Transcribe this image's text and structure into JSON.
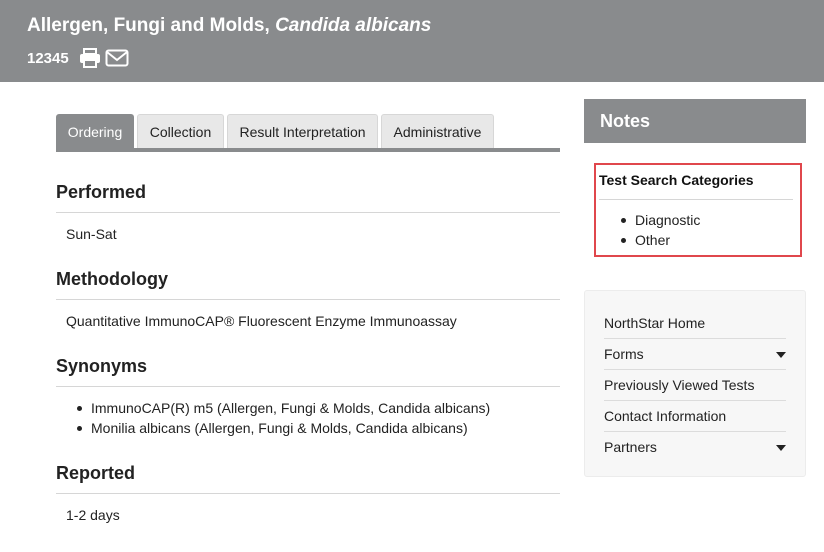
{
  "header": {
    "title_main": "Allergen, Fungi and Molds, ",
    "title_italic": "Candida albicans",
    "code": "12345",
    "print_icon": "printer-icon",
    "email_icon": "envelope-icon"
  },
  "tabs": [
    {
      "label": "Ordering",
      "active": true
    },
    {
      "label": "Collection",
      "active": false
    },
    {
      "label": "Result Interpretation",
      "active": false
    },
    {
      "label": "Administrative",
      "active": false
    }
  ],
  "sections": {
    "performed": {
      "title": "Performed",
      "value": "Sun-Sat"
    },
    "methodology": {
      "title": "Methodology",
      "value": "Quantitative ImmunoCAP® Fluorescent Enzyme Immunoassay"
    },
    "synonyms": {
      "title": "Synonyms",
      "items": [
        "ImmunoCAP(R) m5 (Allergen, Fungi & Molds, Candida albicans)",
        "Monilia albicans (Allergen, Fungi & Molds, Candida albicans)"
      ]
    },
    "reported": {
      "title": "Reported",
      "value": "1-2 days"
    }
  },
  "notes": {
    "title": "Notes",
    "categories_title": "Test Search Categories",
    "categories": [
      "Diagnostic",
      "Other"
    ],
    "highlight_color": "#e0474c"
  },
  "nav": {
    "items": [
      {
        "label": "NorthStar Home",
        "has_dropdown": false
      },
      {
        "label": "Forms",
        "has_dropdown": true
      },
      {
        "label": "Previously Viewed Tests",
        "has_dropdown": false
      },
      {
        "label": "Contact Information",
        "has_dropdown": false
      },
      {
        "label": "Partners",
        "has_dropdown": true
      }
    ]
  },
  "colors": {
    "header_bg": "#898b8d",
    "accent": "#898b8d"
  }
}
